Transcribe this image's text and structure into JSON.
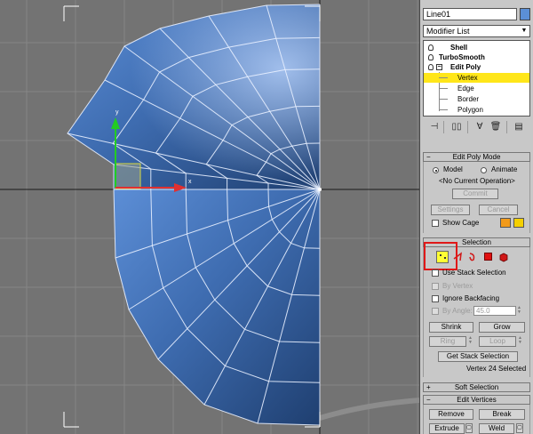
{
  "object_name": "Line01",
  "object_color": "#5b8fd6",
  "modifier_list_label": "Modifier List",
  "stack": {
    "items": [
      {
        "label": "Shell"
      },
      {
        "label": "TurboSmooth"
      },
      {
        "label": "Edit Poly"
      },
      {
        "label": "Vertex"
      },
      {
        "label": "Edge"
      },
      {
        "label": "Border"
      },
      {
        "label": "Polygon"
      }
    ]
  },
  "stack_tools": [
    "pin-stack-icon",
    "show-end-result-icon",
    "make-unique-icon",
    "remove-modifier-icon",
    "configure-modifier-sets-icon"
  ],
  "edit_poly_mode": {
    "title": "Edit Poly Mode",
    "model_label": "Model",
    "animate_label": "Animate",
    "operation_text": "<No Current Operation>",
    "commit_label": "Commit",
    "settings_label": "Settings",
    "cancel_label": "Cancel",
    "show_cage_label": "Show Cage",
    "cage_colors": [
      "#f29a1a",
      "#f5d000"
    ]
  },
  "selection": {
    "title": "Selection",
    "use_stack_selection": "Use Stack Selection",
    "by_vertex": "By Vertex",
    "ignore_backfacing": "Ignore Backfacing",
    "by_angle": "By Angle:",
    "angle_value": "45.0",
    "shrink_label": "Shrink",
    "grow_label": "Grow",
    "ring_label": "Ring",
    "loop_label": "Loop",
    "get_stack_selection_label": "Get Stack Selection",
    "status_text": "Vertex 24 Selected"
  },
  "soft_selection": {
    "title": "Soft Selection"
  },
  "edit_vertices": {
    "title": "Edit Vertices",
    "remove_label": "Remove",
    "break_label": "Break",
    "extrude_label": "Extrude",
    "weld_label": "Weld"
  },
  "viewport": {
    "gizmo_x_label": "x",
    "gizmo_y_label": "y",
    "background_color": "#737373",
    "mesh_color": "#4a7ac0"
  },
  "colors": {
    "highlight_yellow": "#ffe61a",
    "annotation_red": "#e01818"
  }
}
